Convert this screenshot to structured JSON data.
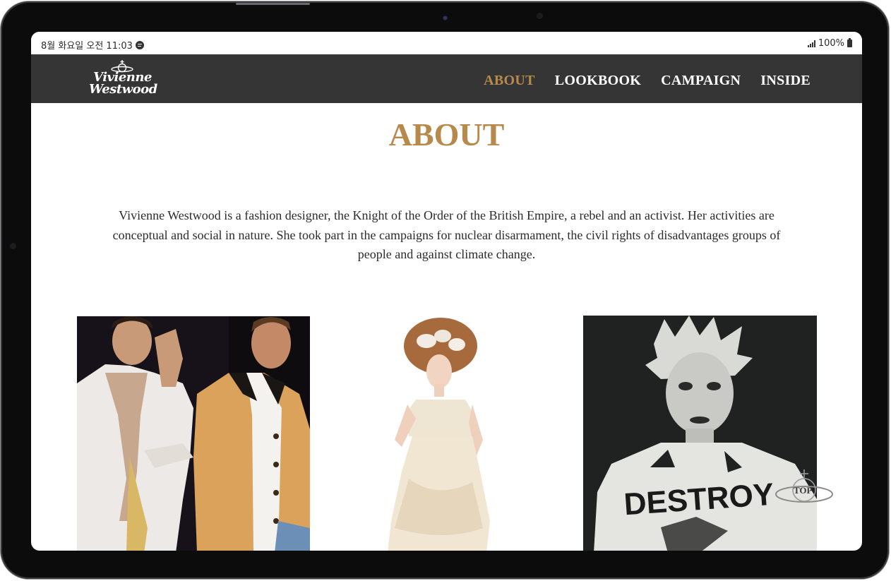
{
  "status_bar": {
    "time": "8월 화요일 오전 11:03",
    "battery": "100%",
    "icons": [
      "spotify-icon",
      "signal-icon",
      "battery-icon"
    ]
  },
  "nav": {
    "logo_line1": "Vivienne",
    "logo_line2": "Westwood",
    "links": [
      {
        "label": "ABOUT",
        "active": true
      },
      {
        "label": "LOOKBOOK",
        "active": false
      },
      {
        "label": "CAMPAIGN",
        "active": false
      },
      {
        "label": "INSIDE",
        "active": false
      }
    ]
  },
  "main": {
    "title": "ABOUT",
    "paragraph": "Vivienne Westwood is a fashion designer, the Knight of the Order of the British Empire, a rebel and an activist. Her activities are conceptual and social in nature. She took part in the campaigns for nuclear disarmament, the civil rights of disadvantages groups of people and against climate change.",
    "photo_print_text": "DESTROY"
  },
  "top_button": {
    "label": "TOP"
  },
  "colors": {
    "accent": "#b78a4c",
    "nav_bg": "#353535",
    "text": "#2b2b2b",
    "frame": "#0c0c0d"
  }
}
